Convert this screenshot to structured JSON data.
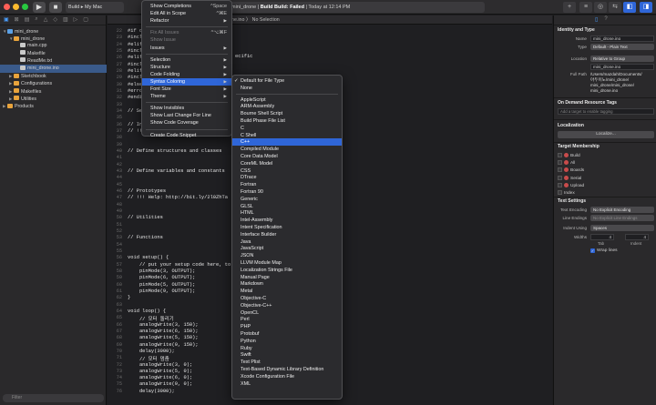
{
  "toolbar": {
    "scheme": "Build ▸ My Mac",
    "status_prefix": "mini_drone | ",
    "status_bold": "Build Build: Failed",
    "status_suffix": " | Today at 12:14 PM",
    "colors": {
      "close": "#ff5f57",
      "minimize": "#febc2e",
      "zoom": "#28c840"
    }
  },
  "navigator": {
    "tree": [
      {
        "label": "mini_drone",
        "kind": "proj",
        "indent": 0,
        "expanded": true
      },
      {
        "label": "mini_drone",
        "kind": "folder",
        "indent": 1,
        "expanded": true
      },
      {
        "label": "main.cpp",
        "kind": "file",
        "indent": 2
      },
      {
        "label": "Makefile",
        "kind": "file",
        "indent": 2
      },
      {
        "label": "ReadMe.txt",
        "kind": "file",
        "indent": 2
      },
      {
        "label": "mini_drone.ino",
        "kind": "file",
        "indent": 2,
        "selected": true
      },
      {
        "label": "Sketchbook",
        "kind": "folder",
        "indent": 1,
        "expanded": false
      },
      {
        "label": "Configurations",
        "kind": "folder",
        "indent": 1,
        "expanded": false
      },
      {
        "label": "Makefiles",
        "kind": "folder",
        "indent": 1,
        "expanded": false
      },
      {
        "label": "Utilities",
        "kind": "folder",
        "indent": 1,
        "expanded": false
      },
      {
        "label": "Products",
        "kind": "folder",
        "indent": 0,
        "expanded": false
      }
    ],
    "filter_placeholder": "Filter"
  },
  "editor": {
    "jumpbar": "ne.ino 〉 No Selection",
    "lines": [
      {
        "n": "",
        "text": "#if d"
      },
      {
        "n": "",
        "text": "#incl"
      },
      {
        "n": "",
        "text": "#elif"
      },
      {
        "n": "",
        "text": "#incl"
      },
      {
        "n": "",
        "text": "#elif"
      },
      {
        "n": "",
        "text": "#incl"
      },
      {
        "n": "",
        "text": "#elif"
      },
      {
        "n": "",
        "text": "#incl"
      },
      {
        "n": "",
        "text": "#else"
      },
      {
        "n": "",
        "text": "#erro"
      },
      {
        "n": "",
        "text": "#endi"
      },
      {
        "n": "",
        "text": ""
      },
      {
        "n": "",
        "text": "// Se"
      },
      {
        "n": "",
        "text": ""
      },
      {
        "n": "",
        "text": "// In"
      },
      {
        "n": "",
        "text": "// !!"
      },
      {
        "n": "",
        "text": ""
      },
      {
        "n": "",
        "text": ""
      },
      {
        "n": "",
        "text": "// Define structures and classes"
      },
      {
        "n": "",
        "text": ""
      },
      {
        "n": "",
        "text": ""
      },
      {
        "n": "",
        "text": "// Define variables and constants"
      },
      {
        "n": "",
        "text": ""
      },
      {
        "n": "",
        "text": ""
      },
      {
        "n": "",
        "text": "// Prototypes"
      },
      {
        "n": "",
        "text": "// !!! Help: http://bit.ly/2l0ZhTa"
      },
      {
        "n": "",
        "text": ""
      },
      {
        "n": "",
        "text": ""
      },
      {
        "n": "",
        "text": "// Utilities"
      },
      {
        "n": "",
        "text": ""
      },
      {
        "n": "",
        "text": ""
      },
      {
        "n": "",
        "text": "// Functions"
      },
      {
        "n": "",
        "text": ""
      },
      {
        "n": "",
        "text": ""
      },
      {
        "n": "",
        "text": "void setup() {"
      },
      {
        "n": "",
        "text": "    // put your setup code here, to"
      },
      {
        "n": "",
        "text": "    pinMode(3, OUTPUT);"
      },
      {
        "n": "",
        "text": "    pinMode(6, OUTPUT);"
      },
      {
        "n": "",
        "text": "    pinMode(5, OUTPUT);"
      },
      {
        "n": "",
        "text": "    pinMode(9, OUTPUT);"
      },
      {
        "n": "",
        "text": "}"
      },
      {
        "n": "",
        "text": ""
      },
      {
        "n": "",
        "text": "void loop() {"
      },
      {
        "n": "",
        "text": "    // 모터 돌리기"
      },
      {
        "n": "",
        "text": "    analogWrite(3, 150);"
      },
      {
        "n": "",
        "text": "    analogWrite(6, 150);"
      },
      {
        "n": "",
        "text": "    analogWrite(5, 150);"
      },
      {
        "n": "",
        "text": "    analogWrite(9, 150);"
      },
      {
        "n": "",
        "text": "    delay(3000);"
      },
      {
        "n": "",
        "text": "    // 모터 멈춤"
      },
      {
        "n": "",
        "text": "    analogWrite(3, 0);"
      },
      {
        "n": "",
        "text": "    analogWrite(5, 0);"
      },
      {
        "n": "",
        "text": "    analogWrite(6, 0);"
      },
      {
        "n": "",
        "text": "    analogWrite(9, 0);"
      },
      {
        "n": "",
        "text": "    delay(3000);"
      }
    ],
    "numbered": [
      "22",
      "23",
      "24",
      "25",
      "26",
      "27",
      "28",
      "29",
      "30",
      "31",
      "32",
      "33",
      "34",
      "35",
      "36",
      "37",
      "38",
      "39",
      "40",
      "41",
      "42",
      "43",
      "44",
      "45",
      "46",
      "47",
      "48",
      "49",
      "50",
      "51",
      "52",
      "53",
      "54",
      "55",
      "56",
      "57",
      "58",
      "59",
      "60",
      "61",
      "62",
      "63",
      "64",
      "65",
      "66",
      "67",
      "68",
      "69",
      "70",
      "71",
      "72",
      "73",
      "74",
      "75",
      "76"
    ],
    "right_text": [
      {
        "line": 2,
        "text": "ecific"
      },
      {
        "line": 5,
        "text": "specific"
      },
      {
        "line": 7,
        "text": "ecific"
      },
      {
        "line": 9,
        "text": "t specific"
      }
    ]
  },
  "editor_menu": {
    "items": [
      {
        "label": "Show Completions",
        "shortcut": "^Space"
      },
      {
        "label": "Edit All in Scope",
        "shortcut": "^⌘E"
      },
      {
        "label": "Refactor",
        "submenu": true
      },
      {
        "sep": true
      },
      {
        "label": "Fix All Issues",
        "shortcut": "^⌥⌘F",
        "disabled": true
      },
      {
        "label": "Show Issue",
        "disabled": true
      },
      {
        "label": "Issues",
        "submenu": true
      },
      {
        "sep": true
      },
      {
        "label": "Selection",
        "submenu": true
      },
      {
        "label": "Structure",
        "submenu": true
      },
      {
        "label": "Code Folding",
        "submenu": true
      },
      {
        "label": "Syntax Coloring",
        "submenu": true,
        "highlighted": true
      },
      {
        "label": "Font Size",
        "submenu": true
      },
      {
        "label": "Theme",
        "submenu": true
      },
      {
        "sep": true
      },
      {
        "label": "Show Invisibles"
      },
      {
        "label": "Show Last Change For Line"
      },
      {
        "label": "Show Code Coverage"
      },
      {
        "sep": true
      },
      {
        "label": "Create Code Snippet"
      }
    ]
  },
  "syntax_menu": {
    "items": [
      {
        "label": "Default for File Type",
        "checked": true
      },
      {
        "label": "None"
      },
      {
        "sep": true
      },
      {
        "label": "AppleScript"
      },
      {
        "label": "ARM-Assembly"
      },
      {
        "label": "Bourne Shell Script"
      },
      {
        "label": "Build Phase File List"
      },
      {
        "label": "C"
      },
      {
        "label": "C Shell"
      },
      {
        "label": "C++",
        "highlighted": true
      },
      {
        "label": "Compiled Module"
      },
      {
        "label": "Core Data Model"
      },
      {
        "label": "CoreML Model"
      },
      {
        "label": "CSS"
      },
      {
        "label": "DTrace"
      },
      {
        "label": "Fortran"
      },
      {
        "label": "Fortran 90"
      },
      {
        "label": "Generic"
      },
      {
        "label": "GLSL"
      },
      {
        "label": "HTML"
      },
      {
        "label": "Intel-Assembly"
      },
      {
        "label": "Intent Specification"
      },
      {
        "label": "Interface Builder"
      },
      {
        "label": "Java"
      },
      {
        "label": "JavaScript"
      },
      {
        "label": "JSON"
      },
      {
        "label": "LLVM Module Map"
      },
      {
        "label": "Localization Strings File"
      },
      {
        "label": "Manual Page"
      },
      {
        "label": "Markdown"
      },
      {
        "label": "Metal"
      },
      {
        "label": "Objective-C"
      },
      {
        "label": "Objective-C++"
      },
      {
        "label": "OpenCL"
      },
      {
        "label": "Perl"
      },
      {
        "label": "PHP"
      },
      {
        "label": "Protobuf"
      },
      {
        "label": "Python"
      },
      {
        "label": "Ruby"
      },
      {
        "label": "Swift"
      },
      {
        "label": "Text Plist"
      },
      {
        "label": "Text-Based Dynamic Library Definition"
      },
      {
        "label": "Xcode Configuration File"
      },
      {
        "label": "XML"
      }
    ]
  },
  "inspector": {
    "identity_title": "Identity and Type",
    "name_label": "Name",
    "name_value": "mini_drone.ino",
    "type_label": "Type",
    "type_value": "Default - Plain Text",
    "location_label": "Location",
    "location_value": "Relative to Group",
    "location_file": "mini_drone.ino",
    "fullpath_label": "Full Path",
    "fullpath_lines": [
      "/Users/mazdah/Documents/",
      "아두이노/mini_drone/",
      "mini_drone/mini_drone/",
      "mini_drone.ino"
    ],
    "odr_title": "On Demand Resource Tags",
    "odr_hint": "Add a target to enable tagging",
    "loc_title": "Localization",
    "localize_button": "Localize...",
    "target_title": "Target Membership",
    "targets": [
      "Build",
      "All",
      "Boards",
      "Serial",
      "Upload",
      "Index"
    ],
    "text_title": "Text Settings",
    "encoding_label": "Text Encoding",
    "encoding_value": "No Explicit Encoding",
    "endings_label": "Line Endings",
    "endings_value": "No Explicit Line Endings",
    "indent_label": "Indent Using",
    "indent_value": "Spaces",
    "widths_label": "Widths",
    "tab_width": "4",
    "indent_width": "4",
    "tab_label": "Tab",
    "indent_sub_label": "Indent",
    "wrap_label": "Wrap lines"
  }
}
